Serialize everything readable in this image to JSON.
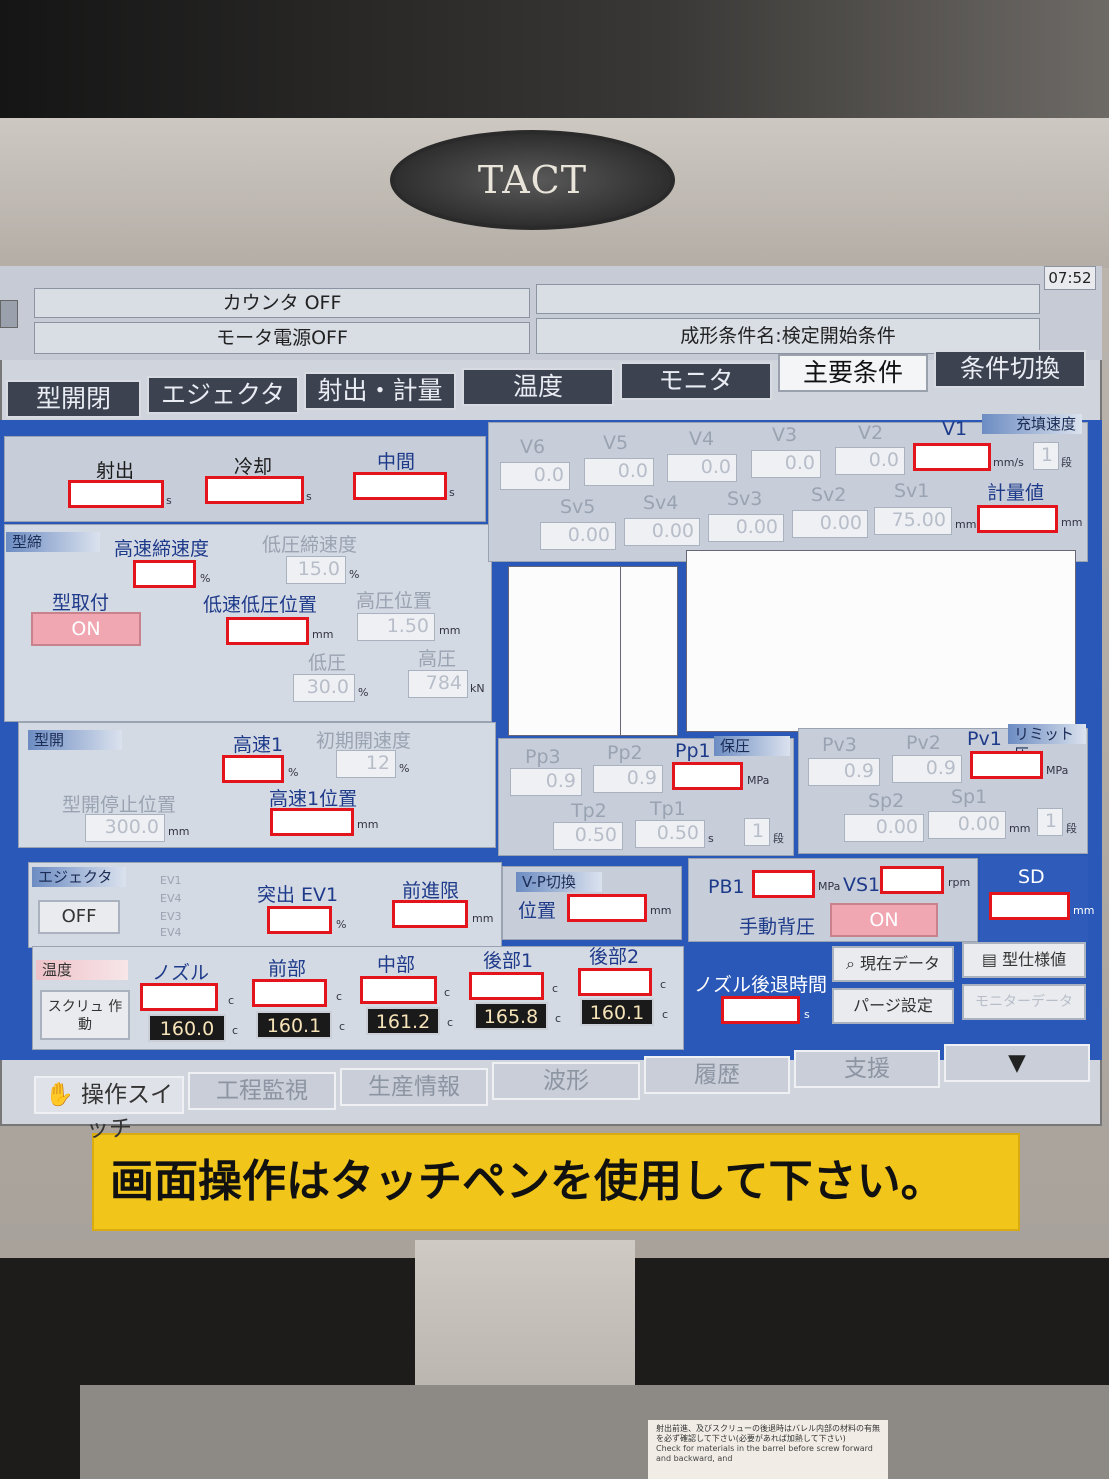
{
  "hardware": {
    "brand": "TACT",
    "label": "画面操作はタッチペンを使用して下さい。",
    "warning_sticker_jp": "射出前進、及びスクリューの後退時はバレル内部の材料の有無を必ず確認して下さい(必要があれば加熱して下さい)",
    "warning_sticker_en": "Check for materials in the barrel before screw forward and backward, and"
  },
  "header": {
    "counter": "カウンタ OFF",
    "motor": "モータ電源OFF",
    "condition_name": "成形条件名:検定開始条件",
    "clock": "07:52"
  },
  "tabs": [
    {
      "label": "型開閉"
    },
    {
      "label": "エジェクタ"
    },
    {
      "label": "射出・計量"
    },
    {
      "label": "温度"
    },
    {
      "label": "モニタ"
    },
    {
      "label": "主要条件",
      "active": true
    },
    {
      "label": "条件切換"
    }
  ],
  "timers": {
    "inject": "射出",
    "cool": "冷却",
    "middle": "中間",
    "unit": "s"
  },
  "mold_clamp": {
    "tag": "型締",
    "high_speed": "高速締速度",
    "low_pressure_speed": "低圧締速度",
    "low_pressure_speed_value": "15.0",
    "mold_take": "型取付",
    "mold_take_state": "ON",
    "low_speed_low_pressure_pos": "低速低圧位置",
    "high_pressure_pos": "高圧位置",
    "high_pressure_pos_value": "1.50",
    "low_pressure": "低圧",
    "low_pressure_value": "30.0",
    "high_pressure": "高圧",
    "high_pressure_value": "784",
    "unit_pct": "%",
    "unit_mm": "mm",
    "unit_kn": "kN"
  },
  "mold_open": {
    "tag": "型開",
    "high1": "高速1",
    "initial_speed": "初期開速度",
    "initial_speed_value": "12",
    "stop_pos": "型開停止位置",
    "stop_pos_value": "300.0",
    "high1_pos": "高速1位置",
    "unit_pct": "%",
    "unit_mm": "mm"
  },
  "ejector": {
    "tag": "エジェクタ",
    "state": "OFF",
    "ev_labels": [
      "EV1",
      "EV4",
      "EV3",
      "EV4"
    ],
    "push_ev1": "突出 EV1",
    "forward_limit": "前進限",
    "unit_pct": "%",
    "unit_mm": "mm"
  },
  "fill_speed": {
    "tag": "充填速度",
    "labels": [
      "V6",
      "V5",
      "V4",
      "V3",
      "V2",
      "V1"
    ],
    "values": [
      "0.0",
      "0.0",
      "0.0",
      "0.0",
      "0.0"
    ],
    "unit": "mm/s",
    "stage": "1",
    "stage_unit": "段",
    "sv_labels": [
      "Sv5",
      "Sv4",
      "Sv3",
      "Sv2",
      "Sv1"
    ],
    "sv_values": [
      "0.00",
      "0.00",
      "0.00",
      "0.00",
      "75.00"
    ],
    "metering": "計量値",
    "sv_unit": "mm"
  },
  "hold_pressure": {
    "tag": "保圧",
    "labels": [
      "Pp3",
      "Pp2",
      "Pp1"
    ],
    "values": [
      "0.9",
      "0.9"
    ],
    "unit": "MPa",
    "tp_labels": [
      "Tp2",
      "Tp1"
    ],
    "tp_values": [
      "0.50",
      "0.50"
    ],
    "tp_unit": "s",
    "stage": "1",
    "stage_unit": "段"
  },
  "limit_pressure": {
    "tag": "リミット圧",
    "labels": [
      "Pv3",
      "Pv2",
      "Pv1"
    ],
    "values": [
      "0.9",
      "0.9"
    ],
    "unit": "MPa",
    "sp_labels": [
      "Sp2",
      "Sp1"
    ],
    "sp_values": [
      "0.00",
      "0.00"
    ],
    "sp_unit": "mm",
    "stage": "1",
    "stage_unit": "段"
  },
  "vp_switch": {
    "tag": "V-P切換",
    "position": "位置",
    "unit": "mm"
  },
  "back_pressure": {
    "pb1": "PB1",
    "pb1_unit": "MPa",
    "vs1": "VS1",
    "vs1_unit": "rpm",
    "manual": "手動背圧",
    "manual_state": "ON",
    "sd": "SD",
    "sd_unit": "mm"
  },
  "temperature": {
    "tag": "温度",
    "screw_button": "スクリュ 作動",
    "zones": [
      {
        "name": "ノズル",
        "actual": "160.0"
      },
      {
        "name": "前部",
        "actual": "160.1"
      },
      {
        "name": "中部",
        "actual": "161.2"
      },
      {
        "name": "後部1",
        "actual": "165.8"
      },
      {
        "name": "後部2",
        "actual": "160.1"
      }
    ],
    "unit": "c"
  },
  "nozzle_retract": {
    "label": "ノズル後退時間",
    "unit": "s"
  },
  "actions": {
    "current_data": "現在データ",
    "mold_spec": "型仕様値",
    "purge": "パージ設定",
    "other": "モニターデータ"
  },
  "bottom_tabs": [
    {
      "label": "操作スイッチ"
    },
    {
      "label": "工程監視"
    },
    {
      "label": "生産情報"
    },
    {
      "label": "波形"
    },
    {
      "label": "履歴"
    },
    {
      "label": "支援"
    },
    {
      "label": "▼"
    }
  ],
  "colors": {
    "panel_blue": "#2a58b8",
    "highlight_red": "#e3141b",
    "pink_on": "#f0a7b2",
    "label_yellow": "#f2c51a"
  }
}
